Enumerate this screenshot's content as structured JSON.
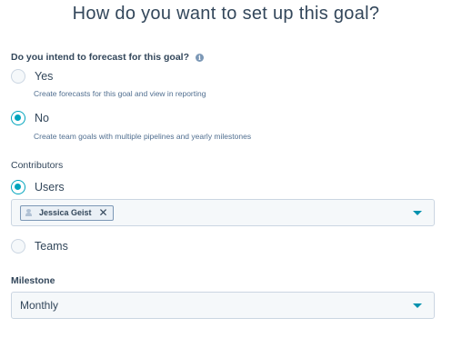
{
  "title": "How do you want to set up this goal?",
  "forecast": {
    "question": "Do you intend to forecast for this goal?",
    "info_icon": "i",
    "options": [
      {
        "label": "Yes",
        "description": "Create forecasts for this goal and view in reporting",
        "selected": false
      },
      {
        "label": "No",
        "description": "Create team goals with multiple pipelines and yearly milestones",
        "selected": true
      }
    ]
  },
  "contributors": {
    "label": "Contributors",
    "users_label": "Users",
    "users_selected": true,
    "selected_user": "Jessica Geist",
    "remove_glyph": "✕",
    "teams_label": "Teams",
    "teams_selected": false
  },
  "milestone": {
    "label": "Milestone",
    "value": "Monthly"
  },
  "colors": {
    "accent": "#00a4bd",
    "caret": "#0091ae",
    "text": "#33475b",
    "field_bg": "#f5f8fa",
    "border": "#cbd6e2"
  }
}
